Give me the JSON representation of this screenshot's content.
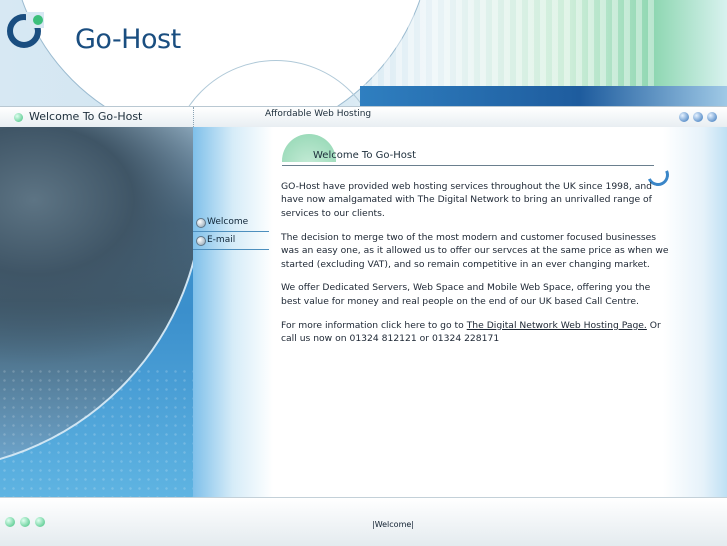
{
  "brand": {
    "name": "Go-Host"
  },
  "navbar": {
    "page_title": "Welcome To Go-Host",
    "tagline": "Affordable Web Hosting"
  },
  "menu": {
    "items": [
      {
        "label": "Welcome"
      },
      {
        "label": "E-mail"
      }
    ]
  },
  "content": {
    "heading": "Welcome To Go-Host",
    "paragraphs": [
      "GO-Host have provided web hosting services throughout the UK since 1998, and have now amalgamated with The Digital Network to bring an unrivalled range of services to our clients.",
      "The decision to merge two of the most modern and customer focused businesses was an easy one, as it allowed us to offer our servces at the same price as when we started (excluding VAT), and so remain competitive in an ever changing market.",
      "We offer Dedicated Servers, Web Space and Mobile Web Space, offering you the best value for money and real people on the end of our UK based Call Centre."
    ],
    "more_info": {
      "prefix": "For more information click here to go to ",
      "link": "The Digital Network Web Hosting Page.",
      "suffix": " Or call us now on 01324 812121 or 01324 228171"
    }
  },
  "footer": {
    "link": "|Welcome|"
  },
  "colors": {
    "brand_blue": "#1a4e80",
    "accent_green": "#3cbf7b",
    "panel_blue": "#3f9ad4"
  }
}
